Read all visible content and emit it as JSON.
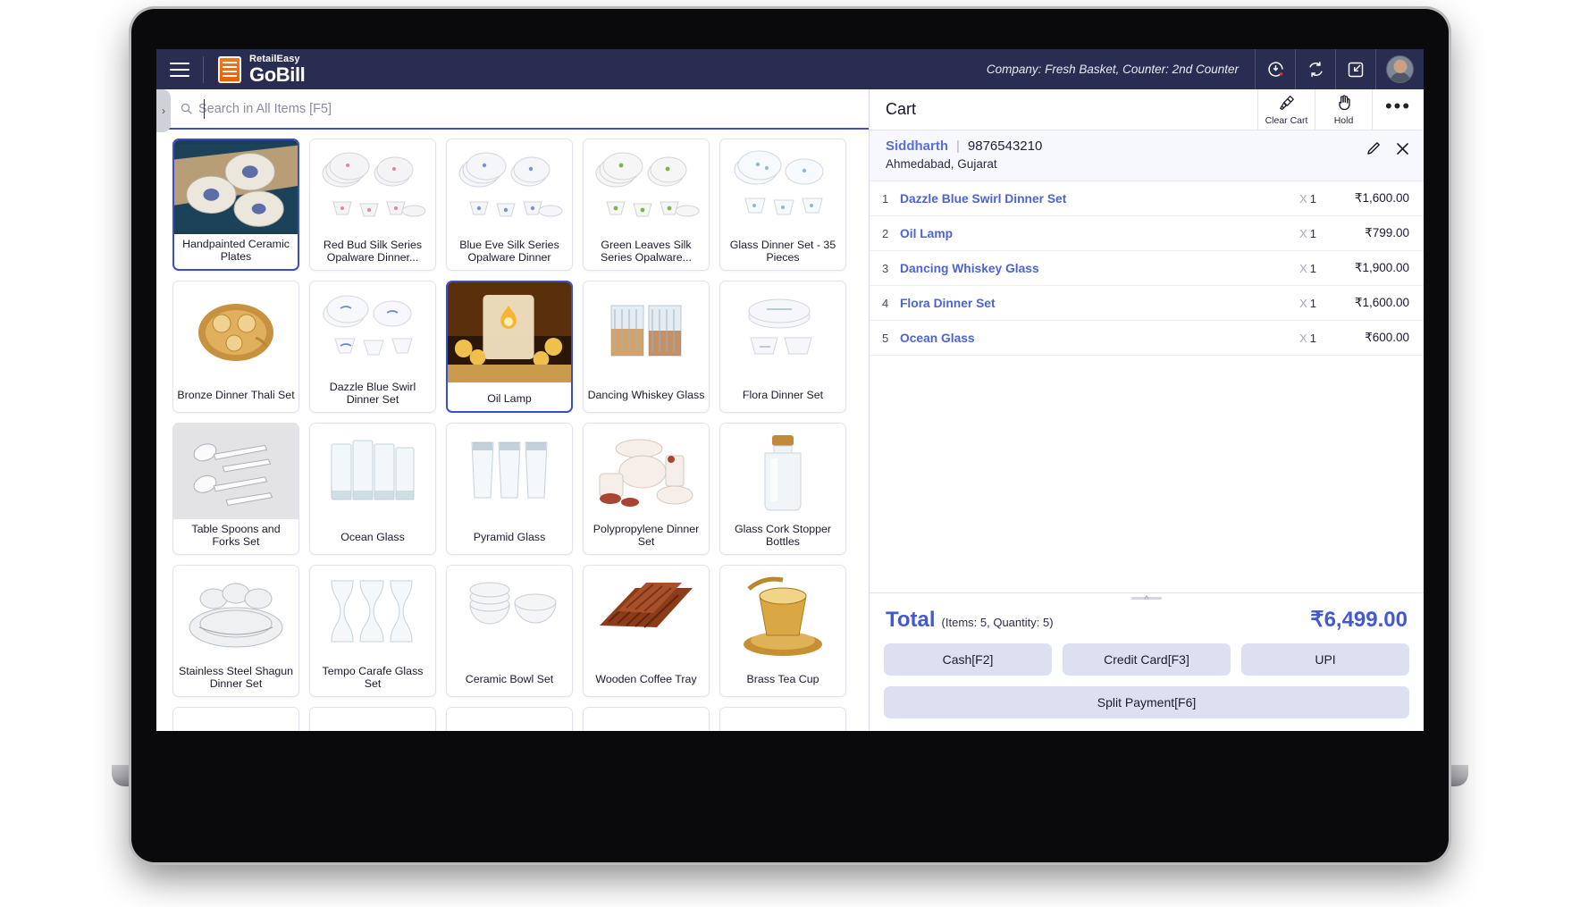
{
  "app": {
    "brand_top": "RetailEasy",
    "brand_bottom": "GoBill",
    "company_counter": "Company: Fresh Basket,  Counter: 2nd Counter",
    "icons": {
      "menu": "hamburger-menu-icon",
      "logo": "gobill-logo-icon",
      "pending": "clock-download-icon",
      "sync": "sync-refresh-icon",
      "collapse": "collapse-screen-icon",
      "avatar": "user-avatar"
    }
  },
  "search": {
    "placeholder": "Search in All Items [F5]",
    "value": "",
    "drawer_toggle": "›"
  },
  "products": {
    "rows": [
      [
        {
          "label": "Handpainted Ceramic Plates",
          "image": "ceramic-plates-photo",
          "selected": true
        },
        {
          "label": "Red Bud Silk Series Opalware Dinner...",
          "image": "red-bud-dinner-set-photo"
        },
        {
          "label": "Blue Eve Silk Series Opalware Dinner",
          "image": "blue-eve-dinner-set-photo"
        },
        {
          "label": "Green Leaves Silk Series Opalware...",
          "image": "green-leaves-dinner-set-photo"
        },
        {
          "label": "Glass Dinner Set - 35 Pieces",
          "image": "glass-dinner-set-photo"
        }
      ],
      [
        {
          "label": "Bronze Dinner Thali Set",
          "image": "bronze-thali-photo"
        },
        {
          "label": "Dazzle Blue Swirl Dinner Set",
          "image": "dazzle-blue-swirl-photo"
        },
        {
          "label": "Oil Lamp",
          "image": "oil-lamp-photo",
          "selected": true
        },
        {
          "label": "Dancing Whiskey Glass",
          "image": "whiskey-glass-photo"
        },
        {
          "label": "Flora Dinner Set",
          "image": "flora-dinner-set-photo"
        }
      ],
      [
        {
          "label": "Table Spoons and Forks Set",
          "image": "spoons-forks-photo"
        },
        {
          "label": "Ocean Glass",
          "image": "ocean-glass-photo"
        },
        {
          "label": "Pyramid Glass",
          "image": "pyramid-glass-photo"
        },
        {
          "label": "Polypropylene Dinner Set",
          "image": "polypropylene-set-photo"
        },
        {
          "label": "Glass Cork Stopper Bottles",
          "image": "cork-bottle-photo"
        }
      ],
      [
        {
          "label": "Stainless Steel Shagun Dinner Set",
          "image": "shagun-dinner-set-photo"
        },
        {
          "label": "Tempo Carafe Glass Set",
          "image": "tempo-carafe-photo"
        },
        {
          "label": "Ceramic Bowl Set",
          "image": "ceramic-bowl-photo"
        },
        {
          "label": "Wooden Coffee Tray",
          "image": "wooden-tray-photo"
        },
        {
          "label": "Brass Tea Cup",
          "image": "brass-tea-cup-photo"
        }
      ],
      [
        {
          "label": "",
          "image": "glass-bowl-photo"
        },
        {
          "label": "",
          "image": "square-container-photo"
        },
        {
          "label": "",
          "image": "plate-stack-photo"
        },
        {
          "label": "",
          "image": "bowl-set-photo"
        },
        {
          "label": "",
          "image": "tumbler-photo"
        }
      ]
    ]
  },
  "cart": {
    "title": "Cart",
    "clear_label": "Clear Cart",
    "hold_label": "Hold",
    "more_label": "•••",
    "customer": {
      "name": "Siddharth",
      "divider": "|",
      "phone": "9876543210",
      "address": "Ahmedabad, Gujarat"
    },
    "items": [
      {
        "index": "1",
        "name": "Dazzle Blue Swirl Dinner Set",
        "qty": "1",
        "qty_prefix": "X",
        "price": "₹1,600.00"
      },
      {
        "index": "2",
        "name": "Oil Lamp",
        "qty": "1",
        "qty_prefix": "X",
        "price": "₹799.00"
      },
      {
        "index": "3",
        "name": "Dancing Whiskey Glass",
        "qty": "1",
        "qty_prefix": "X",
        "price": "₹1,900.00"
      },
      {
        "index": "4",
        "name": "Flora Dinner Set",
        "qty": "1",
        "qty_prefix": "X",
        "price": "₹1,600.00"
      },
      {
        "index": "5",
        "name": "Ocean Glass",
        "qty": "1",
        "qty_prefix": "X",
        "price": "₹600.00"
      }
    ],
    "total_label": "Total",
    "total_meta": "(Items: 5, Quantity: 5)",
    "total_amount": "₹6,499.00",
    "payments": {
      "cash": "Cash[F2]",
      "credit_card": "Credit Card[F3]",
      "upi": "UPI",
      "split": "Split Payment[F6]"
    }
  },
  "colors": {
    "header_bg": "#2a2d52",
    "accent_blue": "#4359d4",
    "link_blue": "#4c63d2",
    "button_bg": "#dde0f0",
    "brand_orange": "#f07c1e"
  }
}
